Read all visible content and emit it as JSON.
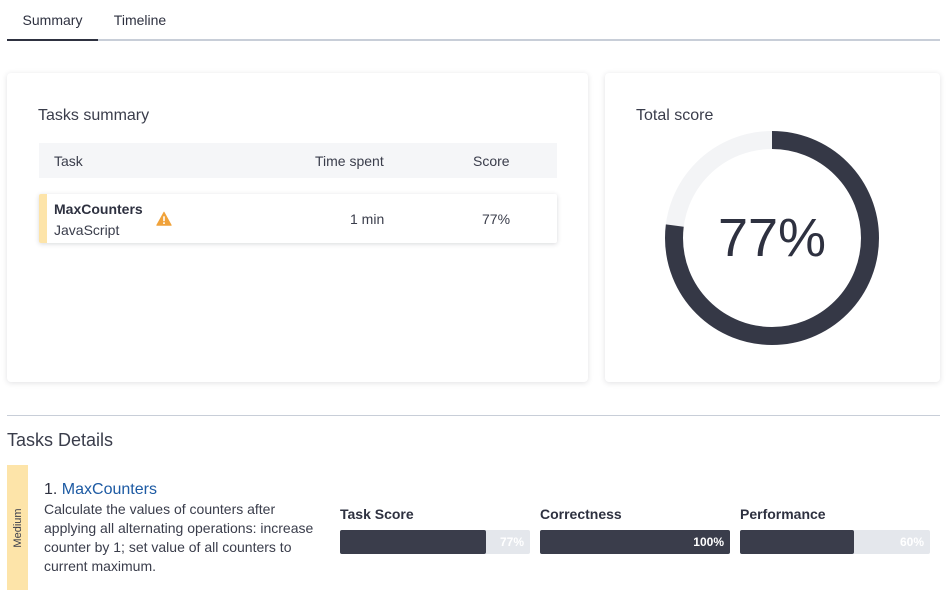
{
  "tabs": [
    {
      "label": "Summary",
      "active": true
    },
    {
      "label": "Timeline",
      "active": false
    }
  ],
  "tasks_summary": {
    "title": "Tasks summary",
    "columns": {
      "task": "Task",
      "time": "Time spent",
      "score": "Score"
    },
    "rows": [
      {
        "name": "MaxCounters",
        "language": "JavaScript",
        "warning_icon": "warning-triangle-icon",
        "time": "1 min",
        "score": "77%"
      }
    ]
  },
  "total_score": {
    "title": "Total score",
    "value": 77,
    "label": "77%",
    "ring_color": "#353846",
    "track_color": "#f3f4f6"
  },
  "details": {
    "title": "Tasks Details",
    "difficulty": "Medium",
    "difficulty_color": "#fde4a9",
    "task_number": "1.",
    "task_name": "MaxCounters",
    "description": "Calculate the values of counters after applying all alternating operations: increase counter by 1; set value of all counters to current maximum.",
    "metrics": [
      {
        "label": "Task Score",
        "value": 77,
        "text": "77%"
      },
      {
        "label": "Correctness",
        "value": 100,
        "text": "100%"
      },
      {
        "label": "Performance",
        "value": 60,
        "text": "60%"
      }
    ]
  },
  "colors": {
    "accent_link": "#1d5aa3",
    "dark": "#353846",
    "warning": "#f0a23a"
  }
}
